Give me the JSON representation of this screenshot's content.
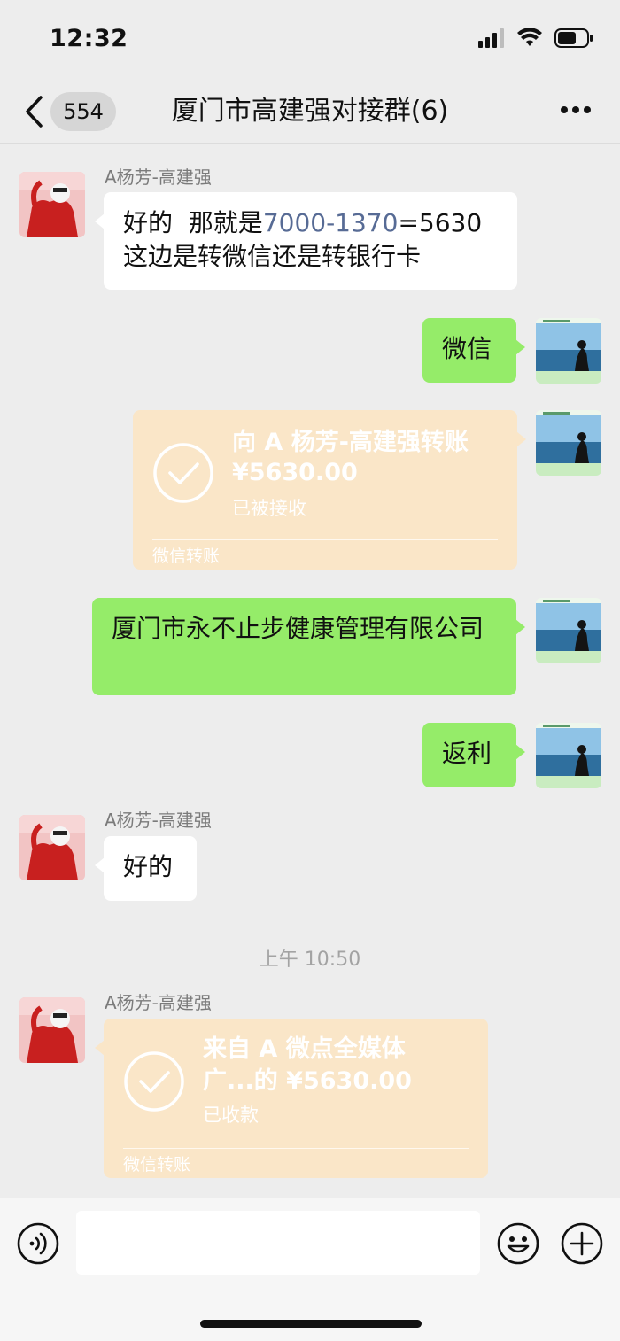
{
  "status_bar": {
    "time": "12:32"
  },
  "nav": {
    "unread_count": "554",
    "title": "厦门市高建强对接群(6)"
  },
  "messages": {
    "m1": {
      "sender": "A杨芳-高建强",
      "text_prefix": "好的  那就是",
      "text_number": "7000-1370",
      "text_suffix": "=5630",
      "text_line2": "这边是转微信还是转银行卡"
    },
    "m2": {
      "text": "微信"
    },
    "m3": {
      "title": "向 A 杨芳-高建强转账",
      "amount": "¥5630.00",
      "status": "已被接收",
      "footer": "微信转账"
    },
    "m4": {
      "text": "厦门市永不止步健康管理有限公司"
    },
    "m5": {
      "text": "返利"
    },
    "m6": {
      "sender": "A杨芳-高建强",
      "text": "好的"
    },
    "timestamp": "上午 10:50",
    "m7": {
      "sender": "A杨芳-高建强",
      "title_line1": "来自 A 微点全媒体",
      "title_line2": "广...的 ¥5630.00",
      "status": "已收款",
      "footer": "微信转账"
    }
  },
  "input": {
    "placeholder": ""
  },
  "colors": {
    "background": "#ededed",
    "outgoing_bubble": "#95ec69",
    "incoming_bubble": "#ffffff",
    "transfer_card": "#fae6c8",
    "link_number": "#576b95"
  }
}
